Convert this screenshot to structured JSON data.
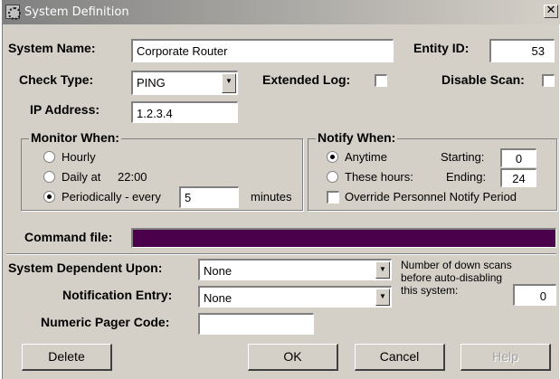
{
  "window": {
    "title": "System Definition",
    "close_glyph": "✕"
  },
  "system": {
    "name_label": "System Name:",
    "name_value": "Corporate Router",
    "entity_label": "Entity ID:",
    "entity_value": "53"
  },
  "check": {
    "type_label": "Check Type:",
    "type_value": "PING",
    "extended_log_label": "Extended Log:",
    "extended_log_checked": false,
    "disable_scan_label": "Disable Scan:",
    "disable_scan_checked": false
  },
  "ip": {
    "label": "IP Address:",
    "value": "1.2.3.4"
  },
  "monitor": {
    "title": "Monitor When:",
    "hourly": "Hourly",
    "daily": "Daily at",
    "daily_time": "22:00",
    "periodically": "Periodically - every",
    "period_value": "5",
    "minutes": "minutes",
    "selected": "periodically"
  },
  "notify": {
    "title": "Notify When:",
    "anytime": "Anytime",
    "these_hours": "These hours:",
    "starting_label": "Starting:",
    "starting_value": "0",
    "ending_label": "Ending:",
    "ending_value": "24",
    "override_label": "Override Personnel Notify Period",
    "override_checked": false,
    "selected": "anytime"
  },
  "command": {
    "label": "Command file:",
    "value": ""
  },
  "dependent": {
    "label": "System Dependent Upon:",
    "value": "None"
  },
  "notification": {
    "label": "Notification Entry:",
    "value": "None"
  },
  "pager": {
    "label": "Numeric Pager Code:",
    "value": ""
  },
  "downscans": {
    "line1": "Number of down scans",
    "line2": "before auto-disabling",
    "line3": "this  system:",
    "value": "0"
  },
  "buttons": {
    "delete": "Delete",
    "ok": "OK",
    "cancel": "Cancel",
    "help": "Help"
  },
  "colors": {
    "command_bar": "#4a004a",
    "face": "#d4d0c8"
  },
  "icons": {
    "title_icon": "system-settings-icon",
    "dropdown": "chevron-down-icon"
  }
}
